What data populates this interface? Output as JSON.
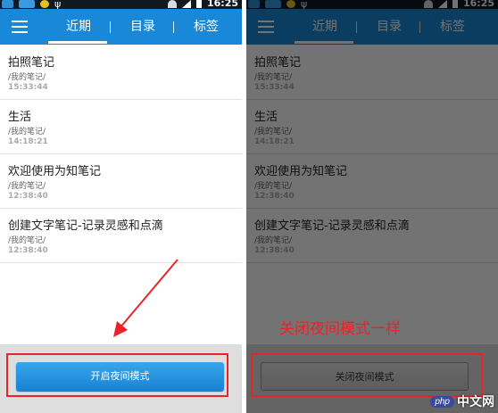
{
  "status": {
    "time": "16:25"
  },
  "tabs": {
    "recent": "近期",
    "catalog": "目录",
    "tags": "标签"
  },
  "notes": [
    {
      "title": "拍照笔记",
      "path": "/我的笔记/",
      "time": "15:33:44"
    },
    {
      "title": "生活",
      "path": "/我的笔记/",
      "time": "14:18:21"
    },
    {
      "title": "欢迎使用为知笔记",
      "path": "/我的笔记/",
      "time": "12:38:40"
    },
    {
      "title": "创建文字笔记-记录灵感和点滴",
      "path": "/我的笔记/",
      "time": "12:38:40"
    }
  ],
  "left": {
    "button_label": "开启夜间模式"
  },
  "right": {
    "button_label": "关闭夜间模式"
  },
  "annotation": "关闭夜间模式一样",
  "watermark": {
    "badge": "php",
    "text": "中文网"
  },
  "colors": {
    "accent": "#1a88d8",
    "highlight": "#e8242a"
  }
}
